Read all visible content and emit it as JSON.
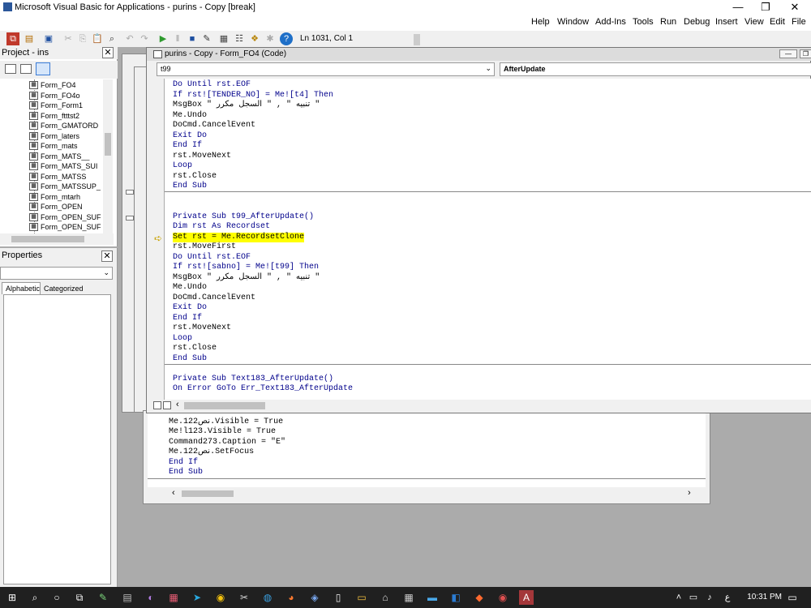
{
  "window": {
    "title": "Microsoft Visual Basic for Applications - purins - Copy [break]",
    "minimize": "—",
    "restore": "❐",
    "close": "✕"
  },
  "menu": [
    "Help",
    "Window",
    "Add-Ins",
    "Tools",
    "Run",
    "Debug",
    "Insert",
    "View",
    "Edit",
    "File"
  ],
  "toolbar": {
    "position": "Ln 1031, Col 1"
  },
  "project": {
    "title": "Project - ins",
    "items": [
      "Form_FO4",
      "Form_FO4o",
      "Form_Form1",
      "Form_ftttst2",
      "Form_GMATORD",
      "Form_laters",
      "Form_mats",
      "Form_MATS__",
      "Form_MATS_SUI",
      "Form_MATSS",
      "Form_MATSSUP_",
      "Form_mtarh",
      "Form_OPEN",
      "Form_OPEN_SUF",
      "Form_OPEN_SUF"
    ]
  },
  "properties": {
    "title": "Properties",
    "tabs": [
      "Alphabetic",
      "Categorized"
    ]
  },
  "code_window": {
    "title": "purins - Copy - Form_FO4 (Code)",
    "object": "t99",
    "procedure": "AfterUpdate",
    "block1": [
      "Do Until rst.EOF",
      "If rst![TENDER_NO] = Me![t4] Then",
      "MsgBox \" تنبيه \" , \" السجل مكرر \"",
      "Me.Undo",
      "DoCmd.CancelEvent",
      "Exit Do",
      "End If",
      "rst.MoveNext",
      "Loop",
      "rst.Close",
      "End Sub"
    ],
    "block2": [
      "Private Sub t99_AfterUpdate()",
      "Dim rst As Recordset",
      "Set rst = Me.RecordsetClone",
      "rst.MoveFirst",
      "Do Until rst.EOF",
      "If rst![sabno] = Me![t99] Then",
      "MsgBox \" تنبيه \" , \" السجل مكرر \"",
      "Me.Undo",
      "DoCmd.CancelEvent",
      "Exit Do",
      "End If",
      "rst.MoveNext",
      "Loop",
      "rst.Close",
      "End Sub"
    ],
    "block3": [
      "Private Sub Text183_AfterUpdate()",
      "On Error GoTo Err_Text183_AfterUpdate"
    ]
  },
  "code_window2": {
    "lines": [
      "Me.نص122.Visible = True",
      "Me!l123.Visible = True",
      "Command273.Caption = \"E\"",
      "Me.نص122.SetFocus",
      "End If",
      "End Sub"
    ]
  },
  "taskbar": {
    "clock": "10:31 PM",
    "lang": "ع"
  }
}
